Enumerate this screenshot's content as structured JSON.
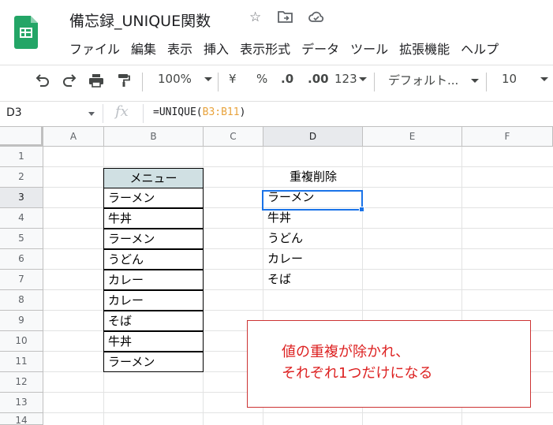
{
  "title_bar": {
    "doc_title": "備忘録_UNIQUE関数",
    "star_icon": "★",
    "move_icon": "folder-move",
    "cloud_icon": "cloud-status"
  },
  "menu": [
    "ファイル",
    "編集",
    "表示",
    "挿入",
    "表示形式",
    "データ",
    "ツール",
    "拡張機能",
    "ヘルプ"
  ],
  "toolbar": {
    "zoom": "100%",
    "currency": "¥",
    "percent": "%",
    "decrease_decimal": ".0",
    "increase_decimal": ".00",
    "number_format": "123",
    "font": "デフォルト...",
    "font_size": "10"
  },
  "formula_bar": {
    "name_box": "D3",
    "fx": "fx",
    "formula_prefix": "=UNIQUE(",
    "formula_ref": "B3:B11",
    "formula_suffix": ")"
  },
  "columns": [
    "A",
    "B",
    "C",
    "D",
    "E",
    "F"
  ],
  "rows": [
    "1",
    "2",
    "3",
    "4",
    "5",
    "6",
    "7",
    "8",
    "9",
    "10",
    "11",
    "12",
    "13",
    "14"
  ],
  "column_b": {
    "header": "メニュー",
    "items": [
      "ラーメン",
      "牛丼",
      "ラーメン",
      "うどん",
      "カレー",
      "カレー",
      "そば",
      "牛丼",
      "ラーメン"
    ]
  },
  "column_d": {
    "header": "重複削除",
    "items": [
      "ラーメン",
      "牛丼",
      "うどん",
      "カレー",
      "そば"
    ]
  },
  "note": {
    "line1": "値の重複が除かれ、",
    "line2": "それぞれ1つだけになる"
  },
  "colors": {
    "sheets_green": "#23a566",
    "header_fill": "#d0e0e3",
    "selection": "#1a73e8",
    "note_red": "#dd2222",
    "formula_ref": "#e8a33d"
  }
}
